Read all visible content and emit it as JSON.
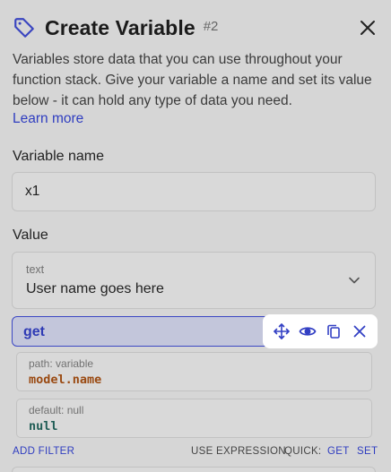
{
  "header": {
    "title": "Create Variable",
    "step": "#2"
  },
  "description": "Variables store data that you can use throughout your function stack. Give your variable a name and set its value below - it can hold any type of data you need.",
  "learn_more": "Learn more",
  "variable_name": {
    "label": "Variable name",
    "value": "x1"
  },
  "value": {
    "label": "Value",
    "type": "text",
    "text": "User name goes here"
  },
  "filter": {
    "name": "get",
    "params": [
      {
        "label": "path: variable",
        "value": "model.name"
      },
      {
        "label": "default: null",
        "value": "null"
      }
    ]
  },
  "footer": {
    "add_filter": "ADD FILTER",
    "use_expression": "USE EXPRESSION",
    "quick": "QUICK:",
    "quick_get": "GET",
    "quick_set": "SET"
  },
  "colors": {
    "accent": "#3340c4",
    "background": "#d6d6d6"
  },
  "icons": [
    "tag-icon",
    "close-icon",
    "chevron-down-icon",
    "move-icon",
    "eye-icon",
    "copy-icon",
    "remove-icon"
  ]
}
